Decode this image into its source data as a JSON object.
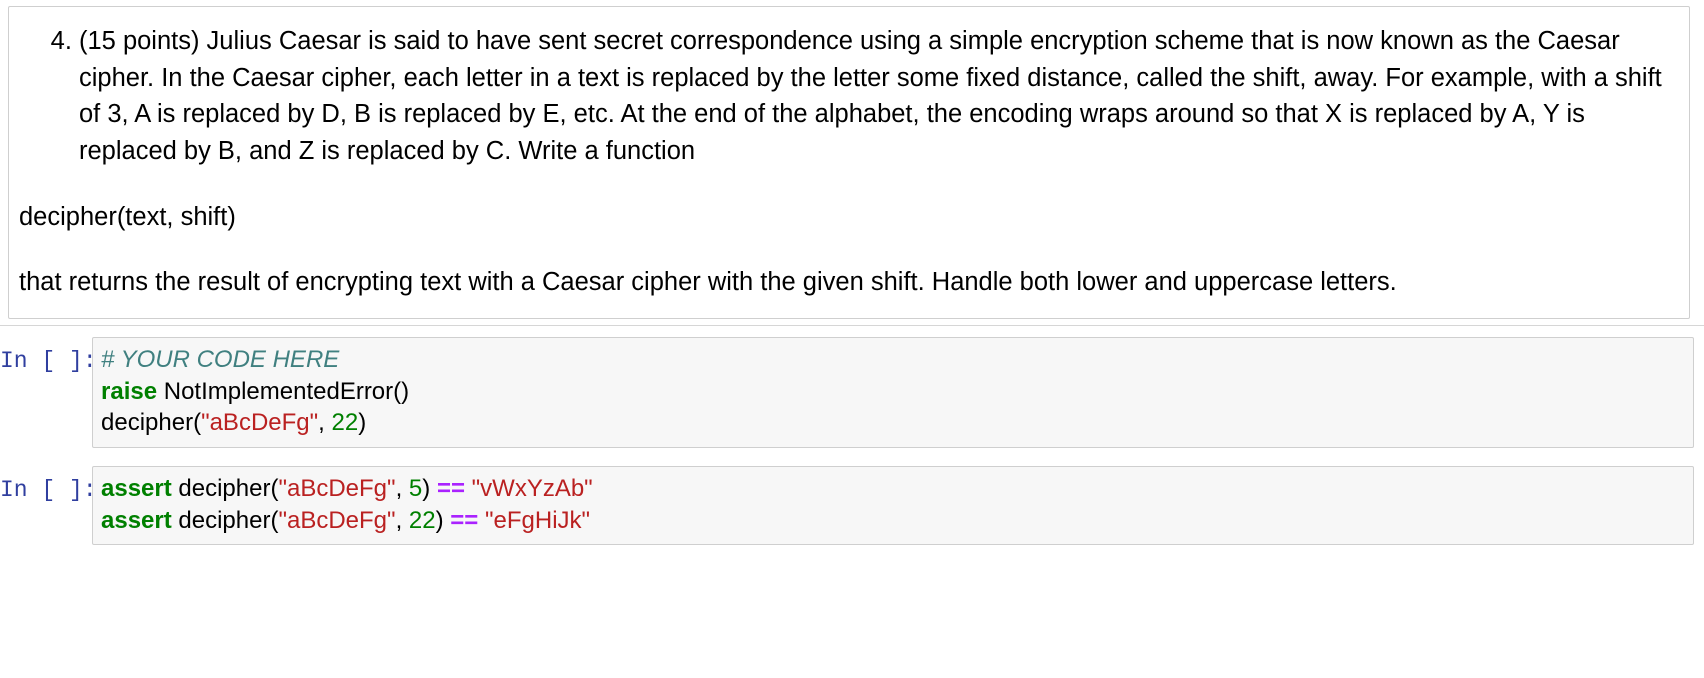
{
  "notebook": {
    "markdown_cell": {
      "item_number": "4.",
      "problem_text": "(15 points) Julius Caesar is said to have sent secret correspondence using a simple encryption scheme that is now known as the Caesar cipher. In the Caesar cipher, each letter in a text is replaced by the letter some fixed distance, called the shift, away. For example, with a shift of 3, A is replaced by D, B is replaced by E, etc. At the end of the alphabet, the encoding wraps around so that X is replaced by A, Y is replaced by B, and Z is replaced by C. Write a function",
      "signature_line": "decipher(text, shift)",
      "closing_text": "that returns the result of encrypting text with a Caesar cipher with the given shift. Handle both lower and uppercase letters."
    },
    "code_cells": [
      {
        "prompt": "In [ ]:",
        "lines": [
          [
            {
              "text": "# YOUR CODE HERE",
              "type": "comment"
            }
          ],
          [
            {
              "text": "raise",
              "type": "keyword"
            },
            {
              "text": " NotImplementedError()",
              "type": "plain"
            }
          ],
          [
            {
              "text": "decipher(",
              "type": "plain"
            },
            {
              "text": "\"aBcDeFg\"",
              "type": "string"
            },
            {
              "text": ", ",
              "type": "plain"
            },
            {
              "text": "22",
              "type": "number"
            },
            {
              "text": ")",
              "type": "plain"
            }
          ]
        ]
      },
      {
        "prompt": "In [ ]:",
        "lines": [
          [
            {
              "text": "assert",
              "type": "keyword"
            },
            {
              "text": " decipher(",
              "type": "plain"
            },
            {
              "text": "\"aBcDeFg\"",
              "type": "string"
            },
            {
              "text": ", ",
              "type": "plain"
            },
            {
              "text": "5",
              "type": "number"
            },
            {
              "text": ") ",
              "type": "plain"
            },
            {
              "text": "==",
              "type": "operator"
            },
            {
              "text": " ",
              "type": "plain"
            },
            {
              "text": "\"vWxYzAb\"",
              "type": "string"
            }
          ],
          [
            {
              "text": "assert",
              "type": "keyword"
            },
            {
              "text": " decipher(",
              "type": "plain"
            },
            {
              "text": "\"aBcDeFg\"",
              "type": "string"
            },
            {
              "text": ", ",
              "type": "plain"
            },
            {
              "text": "22",
              "type": "number"
            },
            {
              "text": ") ",
              "type": "plain"
            },
            {
              "text": "==",
              "type": "operator"
            },
            {
              "text": " ",
              "type": "plain"
            },
            {
              "text": "\"eFgHiJk\"",
              "type": "string"
            }
          ]
        ]
      }
    ],
    "colors": {
      "comment": "#408080",
      "keyword": "#008000",
      "string": "#ba2121",
      "number": "#008000",
      "operator": "#aa22ff",
      "prompt": "#303f9f",
      "code_background": "#f7f7f7",
      "cell_border": "#cfcfcf"
    }
  }
}
